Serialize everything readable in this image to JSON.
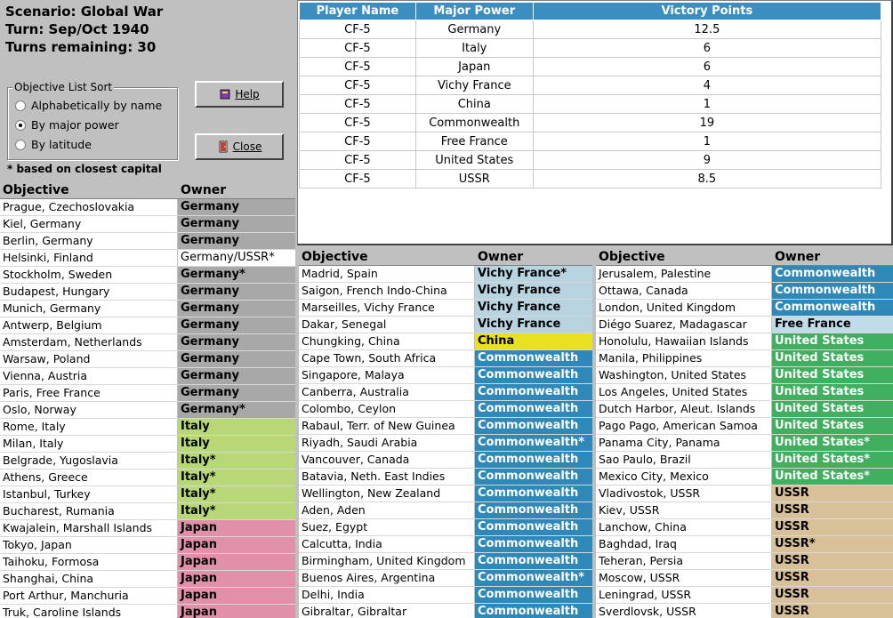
{
  "scenario": {
    "line1": "Scenario: Global War",
    "line2": "Turn: Sep/Oct 1940",
    "line3": "Turns remaining: 30"
  },
  "sort": {
    "legend": "Objective List Sort",
    "options": [
      "Alphabetically by name",
      "By major power",
      "By latitude"
    ],
    "selected": "By major power"
  },
  "buttons": {
    "help": "Help",
    "close": "Close"
  },
  "note": "* based on closest capital",
  "vp_table": {
    "headers": [
      "Player Name",
      "Major Power",
      "Victory Points"
    ],
    "rows": [
      [
        "CF-5",
        "Germany",
        "12.5"
      ],
      [
        "CF-5",
        "Italy",
        "6"
      ],
      [
        "CF-5",
        "Japan",
        "6"
      ],
      [
        "CF-5",
        "Vichy France",
        "4"
      ],
      [
        "CF-5",
        "China",
        "1"
      ],
      [
        "CF-5",
        "Commonwealth",
        "19"
      ],
      [
        "CF-5",
        "Free France",
        "1"
      ],
      [
        "CF-5",
        "United States",
        "9"
      ],
      [
        "CF-5",
        "USSR",
        "8.5"
      ]
    ]
  },
  "owner_colors": {
    "Germany": {
      "bg": "#a8a8a8",
      "fg": "#000000"
    },
    "Germany/USSR": {
      "bg": "#ffffff",
      "fg": "#000000",
      "normal": true
    },
    "Italy": {
      "bg": "#b8d878",
      "fg": "#000000"
    },
    "Japan": {
      "bg": "#e090a8",
      "fg": "#000000"
    },
    "Vichy France": {
      "bg": "#b8d4e0",
      "fg": "#000000"
    },
    "China": {
      "bg": "#e8e020",
      "fg": "#000000"
    },
    "Commonwealth": {
      "bg": "#2e88b8",
      "fg": "#ffffff"
    },
    "Free France": {
      "bg": "#c0dce8",
      "fg": "#000000"
    },
    "United States": {
      "bg": "#40b060",
      "fg": "#ffffff"
    },
    "USSR": {
      "bg": "#d8c098",
      "fg": "#000000"
    }
  },
  "objective_header": {
    "objective": "Objective",
    "owner": "Owner"
  },
  "panel1": [
    [
      "Prague, Czechoslovakia",
      "Germany",
      ""
    ],
    [
      "Kiel, Germany",
      "Germany",
      ""
    ],
    [
      "Berlin, Germany",
      "Germany",
      ""
    ],
    [
      "Helsinki, Finland",
      "Germany/USSR",
      "*"
    ],
    [
      "Stockholm, Sweden",
      "Germany",
      "*"
    ],
    [
      "Budapest, Hungary",
      "Germany",
      ""
    ],
    [
      "Munich, Germany",
      "Germany",
      ""
    ],
    [
      "Antwerp, Belgium",
      "Germany",
      ""
    ],
    [
      "Amsterdam, Netherlands",
      "Germany",
      ""
    ],
    [
      "Warsaw, Poland",
      "Germany",
      ""
    ],
    [
      "Vienna, Austria",
      "Germany",
      ""
    ],
    [
      "Paris, Free France",
      "Germany",
      ""
    ],
    [
      "Oslo, Norway",
      "Germany",
      "*"
    ],
    [
      "Rome, Italy",
      "Italy",
      ""
    ],
    [
      "Milan, Italy",
      "Italy",
      ""
    ],
    [
      "Belgrade, Yugoslavia",
      "Italy",
      "*"
    ],
    [
      "Athens, Greece",
      "Italy",
      "*"
    ],
    [
      "Istanbul, Turkey",
      "Italy",
      "*"
    ],
    [
      "Bucharest, Rumania",
      "Italy",
      "*"
    ],
    [
      "Kwajalein, Marshall Islands",
      "Japan",
      ""
    ],
    [
      "Tokyo, Japan",
      "Japan",
      ""
    ],
    [
      "Taihoku, Formosa",
      "Japan",
      ""
    ],
    [
      "Shanghai, China",
      "Japan",
      ""
    ],
    [
      "Port Arthur, Manchuria",
      "Japan",
      ""
    ],
    [
      "Truk, Caroline Islands",
      "Japan",
      ""
    ]
  ],
  "panel2": [
    [
      "Madrid, Spain",
      "Vichy France",
      "*"
    ],
    [
      "Saigon, French Indo-China",
      "Vichy France",
      ""
    ],
    [
      "Marseilles, Vichy France",
      "Vichy France",
      ""
    ],
    [
      "Dakar, Senegal",
      "Vichy France",
      ""
    ],
    [
      "Chungking, China",
      "China",
      ""
    ],
    [
      "Cape Town, South Africa",
      "Commonwealth",
      ""
    ],
    [
      "Singapore, Malaya",
      "Commonwealth",
      ""
    ],
    [
      "Canberra, Australia",
      "Commonwealth",
      ""
    ],
    [
      "Colombo, Ceylon",
      "Commonwealth",
      ""
    ],
    [
      "Rabaul, Terr. of New Guinea",
      "Commonwealth",
      ""
    ],
    [
      "Riyadh, Saudi Arabia",
      "Commonwealth",
      "*"
    ],
    [
      "Vancouver, Canada",
      "Commonwealth",
      ""
    ],
    [
      "Batavia, Neth. East Indies",
      "Commonwealth",
      ""
    ],
    [
      "Wellington, New Zealand",
      "Commonwealth",
      ""
    ],
    [
      "Aden, Aden",
      "Commonwealth",
      ""
    ],
    [
      "Suez, Egypt",
      "Commonwealth",
      ""
    ],
    [
      "Calcutta, India",
      "Commonwealth",
      ""
    ],
    [
      "Birmingham, United Kingdom",
      "Commonwealth",
      ""
    ],
    [
      "Buenos Aires, Argentina",
      "Commonwealth",
      "*"
    ],
    [
      "Delhi, India",
      "Commonwealth",
      ""
    ],
    [
      "Gibraltar, Gibraltar",
      "Commonwealth",
      ""
    ]
  ],
  "panel3": [
    [
      "Jerusalem, Palestine",
      "Commonwealth",
      ""
    ],
    [
      "Ottawa, Canada",
      "Commonwealth",
      ""
    ],
    [
      "London, United Kingdom",
      "Commonwealth",
      ""
    ],
    [
      "Diégo Suarez, Madagascar",
      "Free France",
      ""
    ],
    [
      "Honolulu, Hawaiian Islands",
      "United States",
      ""
    ],
    [
      "Manila, Philippines",
      "United States",
      ""
    ],
    [
      "Washington, United States",
      "United States",
      ""
    ],
    [
      "Los Angeles, United States",
      "United States",
      ""
    ],
    [
      "Dutch Harbor, Aleut. Islands",
      "United States",
      ""
    ],
    [
      "Pago Pago, American Samoa",
      "United States",
      ""
    ],
    [
      "Panama City, Panama",
      "United States",
      "*"
    ],
    [
      "Sao Paulo, Brazil",
      "United States",
      "*"
    ],
    [
      "Mexico City, Mexico",
      "United States",
      "*"
    ],
    [
      "Vladivostok, USSR",
      "USSR",
      ""
    ],
    [
      "Kiev, USSR",
      "USSR",
      ""
    ],
    [
      "Lanchow, China",
      "USSR",
      ""
    ],
    [
      "Baghdad, Iraq",
      "USSR",
      "*"
    ],
    [
      "Teheran, Persia",
      "USSR",
      ""
    ],
    [
      "Moscow, USSR",
      "USSR",
      ""
    ],
    [
      "Leningrad, USSR",
      "USSR",
      ""
    ],
    [
      "Sverdlovsk, USSR",
      "USSR",
      ""
    ]
  ]
}
